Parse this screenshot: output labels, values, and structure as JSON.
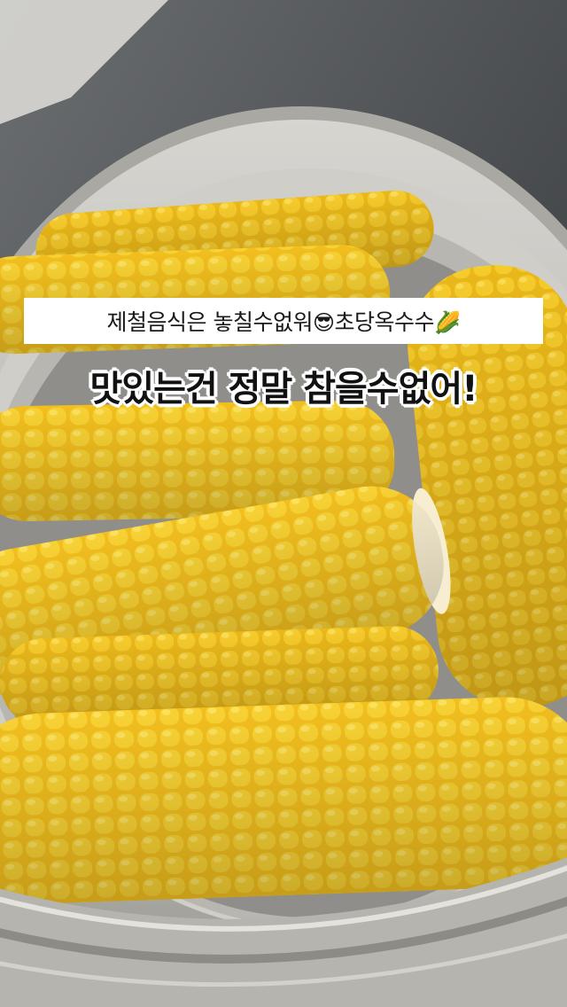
{
  "overlay": {
    "subtitle_text": "제철음식은 놓칠수없워",
    "subtitle_emoji_1": "😎",
    "subtitle_text_2": "초당옥수수",
    "subtitle_emoji_2": "🌽",
    "headline": "맛있는건 정말 참을수없어!"
  },
  "colors": {
    "corn": "#f6c82a",
    "corn_shadow": "#d9a412",
    "steamer": "#c8c7c2",
    "background": "#3a3d40"
  },
  "icons": [
    "sunglasses-emoji-icon",
    "corn-emoji-icon"
  ]
}
